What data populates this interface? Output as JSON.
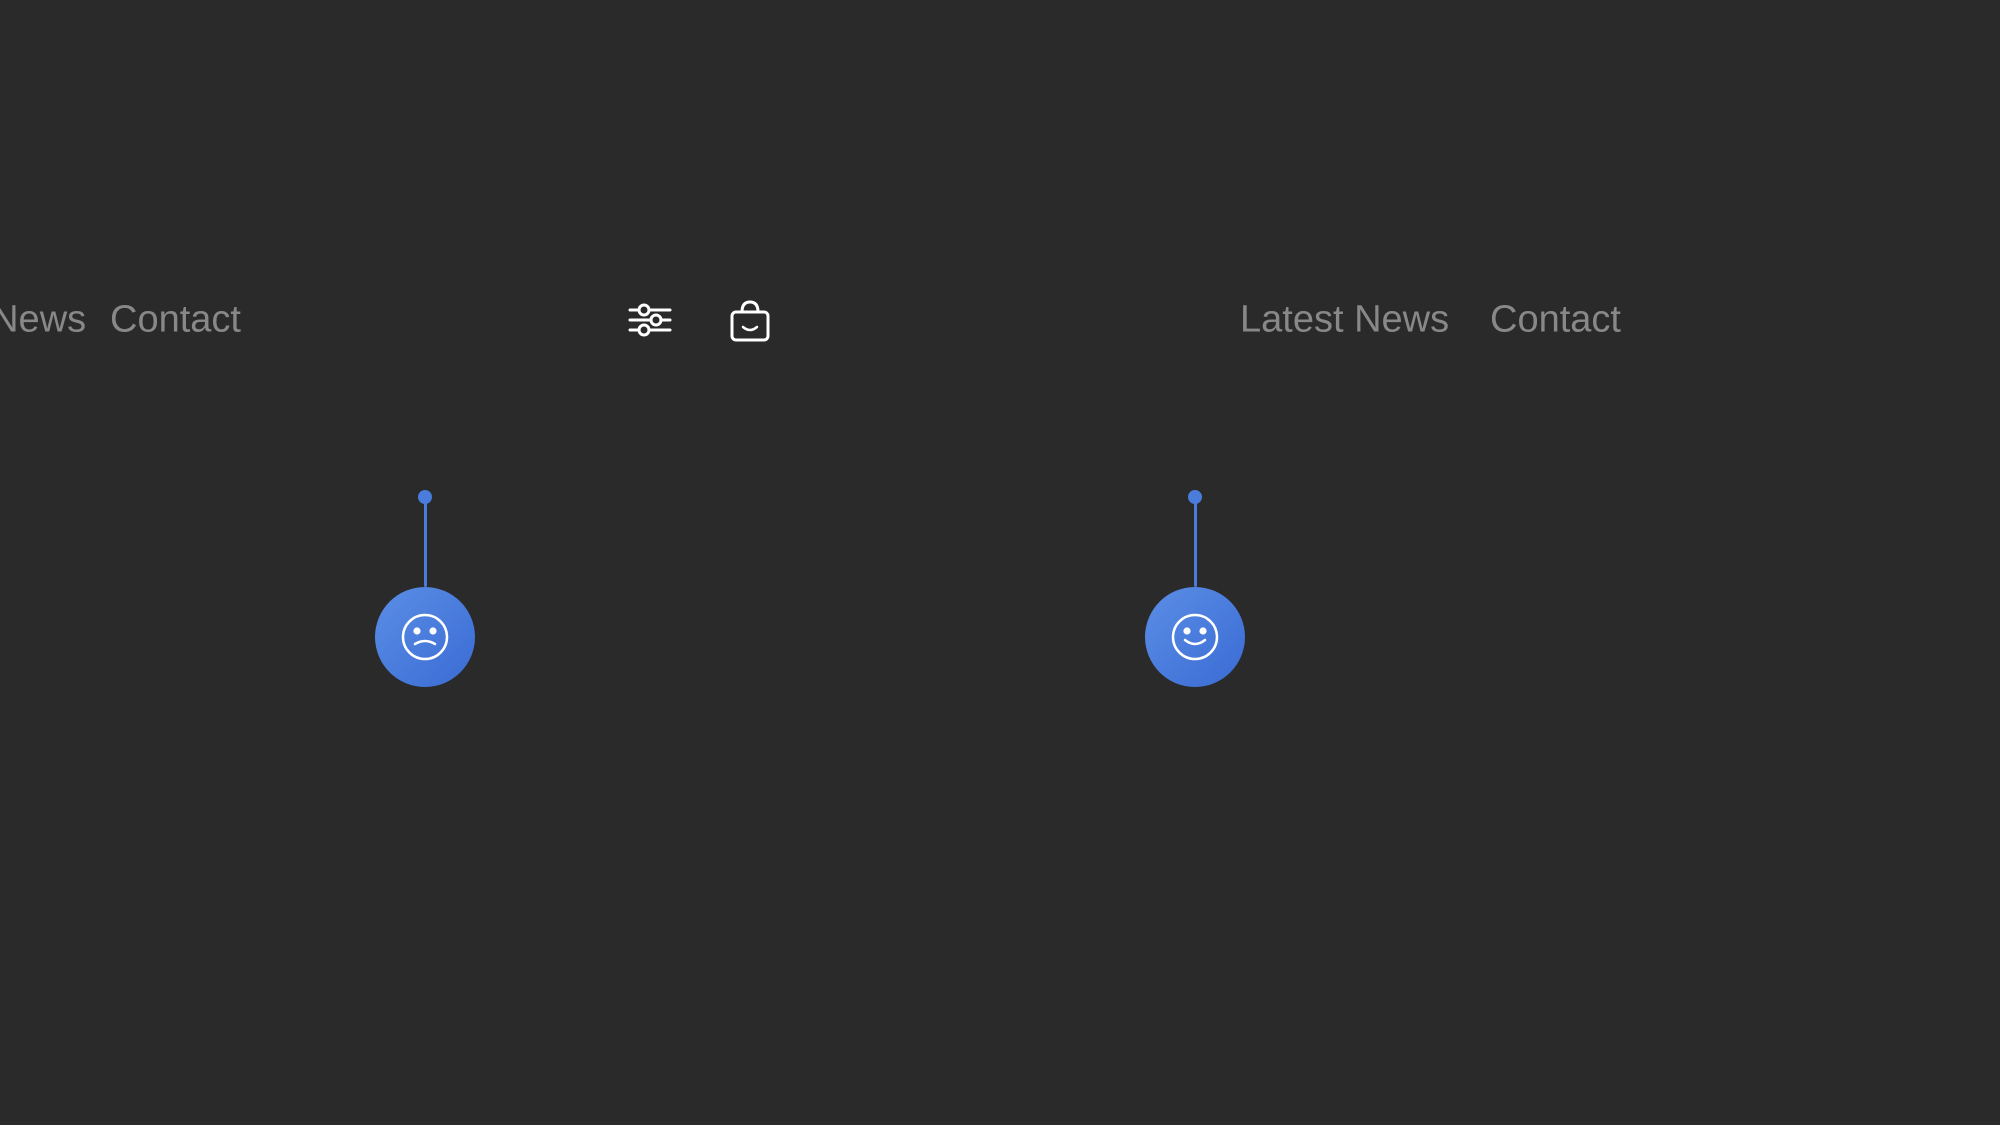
{
  "nav": {
    "left": {
      "news_label": "t News",
      "contact_label": "Contact"
    },
    "right": {
      "latest_news_label": "Latest News",
      "contact_label": "Contact"
    },
    "icons": {
      "filter_icon": "filter-icon",
      "bag_icon": "bag-icon",
      "gear_icon": "gear-icon",
      "cart_icon": "cart-icon"
    }
  },
  "pendulums": {
    "left": {
      "type": "sad",
      "line_height": 100
    },
    "right": {
      "type": "happy",
      "line_height": 100
    }
  },
  "colors": {
    "background": "#2a2a2a",
    "nav_text": "#888888",
    "icon_stroke": "#ffffff",
    "pendulum_blue": "#4a7cdc",
    "pendulum_gradient_start": "#5b8ee6",
    "pendulum_gradient_end": "#3a6bd4"
  }
}
